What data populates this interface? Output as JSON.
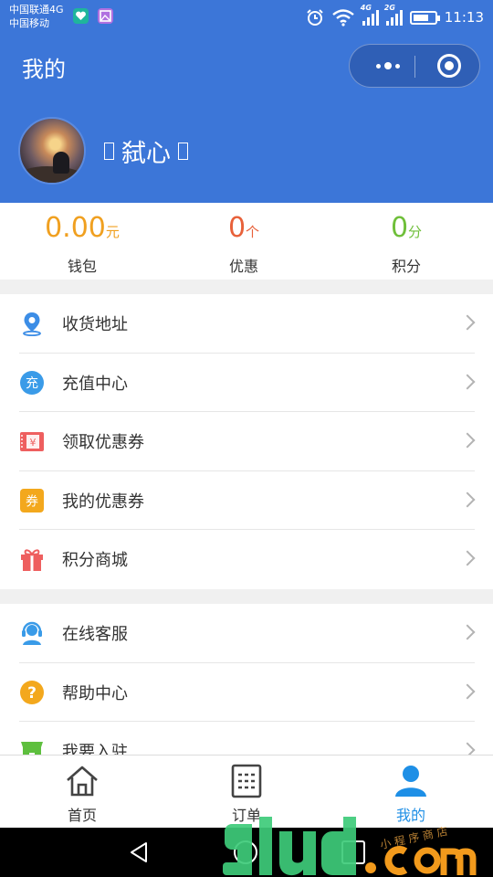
{
  "status_bar": {
    "carrier_1": "中国联通4G",
    "carrier_2": "中国移动",
    "net_1": "4G",
    "net_2": "2G",
    "time": "11:13"
  },
  "header": {
    "title": "我的",
    "nickname": "弑心",
    "bg_color": "#3c76d8"
  },
  "stats": [
    {
      "value": "0.00",
      "unit": "元",
      "label": "钱包",
      "color": "#f0a020"
    },
    {
      "value": "0",
      "unit": "个",
      "label": "优惠",
      "color": "#e8613a"
    },
    {
      "value": "0",
      "unit": "分",
      "label": "积分",
      "color": "#6fbf3a"
    }
  ],
  "menu_group_1": [
    {
      "label": "收货地址",
      "icon": "location-pin-icon"
    },
    {
      "label": "充值中心",
      "icon": "recharge-icon",
      "icon_text": "充"
    },
    {
      "label": "领取优惠券",
      "icon": "coupon-ticket-icon",
      "icon_text": "¥"
    },
    {
      "label": "我的优惠券",
      "icon": "my-coupon-icon",
      "icon_text": "券"
    },
    {
      "label": "积分商城",
      "icon": "gift-icon"
    }
  ],
  "menu_group_2": [
    {
      "label": "在线客服",
      "icon": "customer-service-icon"
    },
    {
      "label": "帮助中心",
      "icon": "help-icon",
      "icon_text": "?"
    },
    {
      "label": "我要入驻",
      "icon": "shop-icon"
    }
  ],
  "tabbar": [
    {
      "label": "首页",
      "icon": "home-icon",
      "active": false
    },
    {
      "label": "订单",
      "icon": "order-list-icon",
      "active": false
    },
    {
      "label": "我的",
      "icon": "user-icon",
      "active": true
    }
  ],
  "colors": {
    "active_tab": "#1e8fe6",
    "inactive_tab": "#333333"
  }
}
